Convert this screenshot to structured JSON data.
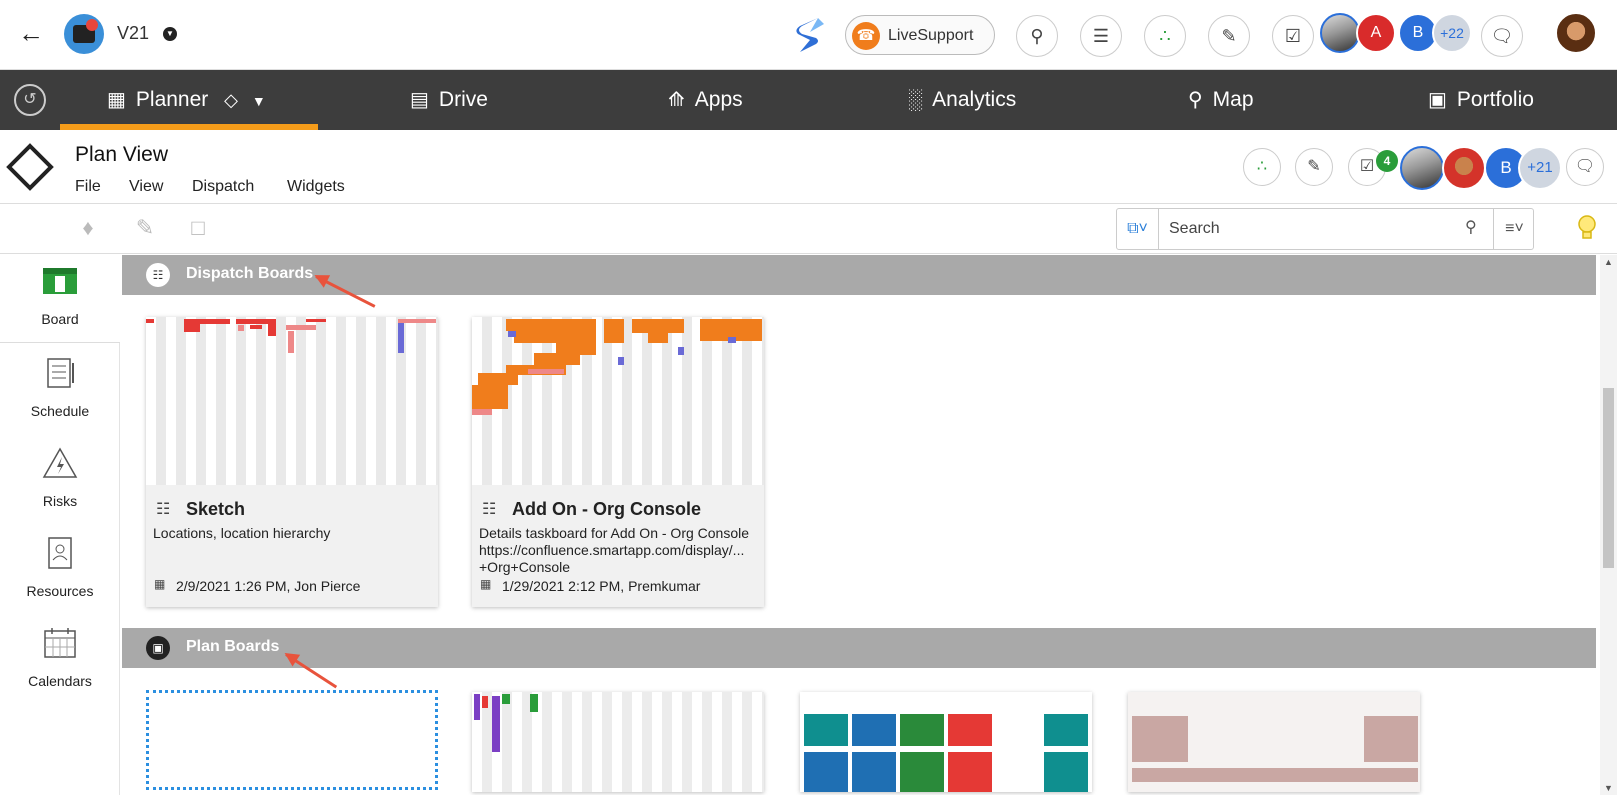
{
  "topbar": {
    "project_name": "V21",
    "livesupport_label": "LiveSupport",
    "avatars_more": "+22",
    "avatar_a": "A",
    "avatar_b": "B"
  },
  "nav": {
    "items": [
      {
        "label": "Planner",
        "icon": "calendar-icon"
      },
      {
        "label": "Drive",
        "icon": "drive-icon"
      },
      {
        "label": "Apps",
        "icon": "apps-icon"
      },
      {
        "label": "Analytics",
        "icon": "analytics-icon"
      },
      {
        "label": "Map",
        "icon": "map-pin-icon"
      },
      {
        "label": "Portfolio",
        "icon": "briefcase-icon"
      }
    ],
    "active_color": "#f59c1a"
  },
  "subheader": {
    "title": "Plan View",
    "menu": [
      "File",
      "View",
      "Dispatch",
      "Widgets"
    ],
    "notif_count": "4",
    "avatar_b": "B",
    "avatars_more": "+21"
  },
  "toolbar": {
    "search_placeholder": "Search"
  },
  "sidebar": {
    "items": [
      {
        "label": "Board",
        "icon": "board-icon"
      },
      {
        "label": "Schedule",
        "icon": "schedule-icon"
      },
      {
        "label": "Risks",
        "icon": "risk-icon"
      },
      {
        "label": "Resources",
        "icon": "resources-icon"
      },
      {
        "label": "Calendars",
        "icon": "calendar-icon"
      }
    ]
  },
  "sections": {
    "dispatch": {
      "title": "Dispatch Boards",
      "cards": [
        {
          "title": "Sketch",
          "description": "Locations, location hierarchy",
          "meta": "2/9/2021 1:26 PM, Jon Pierce"
        },
        {
          "title": "Add On - Org Console",
          "description": "Details taskboard for Add On - Org Console\nhttps://confluence.smartapp.com/display/...\n+Org+Console",
          "meta": "1/29/2021 2:12 PM, Premkumar"
        }
      ]
    },
    "plan": {
      "title": "Plan Boards"
    }
  }
}
